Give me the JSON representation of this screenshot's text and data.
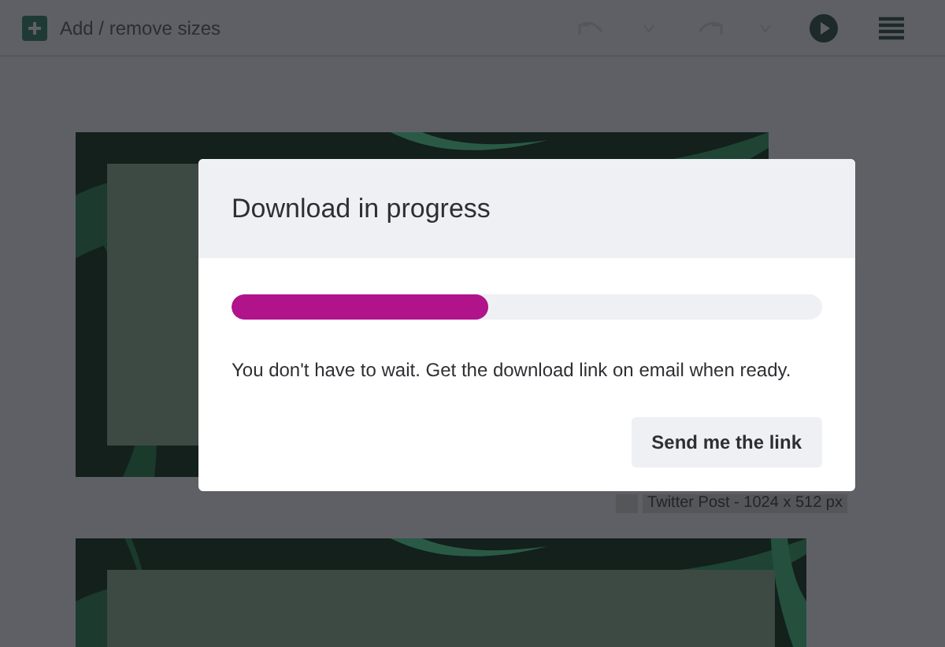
{
  "toolbar": {
    "add_label": "Add / remove sizes"
  },
  "canvas": {
    "size_label": "Twitter Post - 1024 x 512 px"
  },
  "dialog": {
    "title": "Download in progress",
    "progress": {
      "level": 0.435
    },
    "message": "You don't have to wait. Get the download link on email when ready.",
    "button": "Send me the link"
  }
}
